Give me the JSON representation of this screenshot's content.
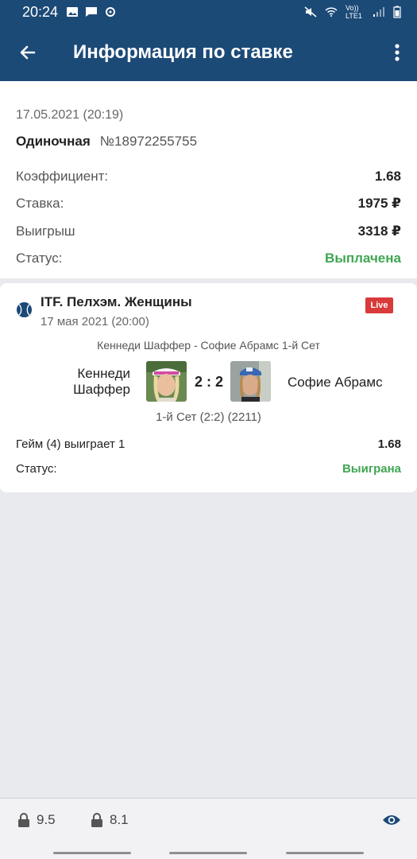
{
  "status_bar": {
    "time": "20:24",
    "network_label": "Vo)) LTE1"
  },
  "appbar": {
    "title": "Информация по ставке",
    "back_icon": "arrow-left-icon",
    "menu_icon": "more-vert-icon"
  },
  "bet": {
    "date": "17.05.2021 (20:19)",
    "type": "Одиночная",
    "number": "№18972255755",
    "rows": [
      {
        "label": "Коэффициент:",
        "value": "1.68"
      },
      {
        "label": "Ставка:",
        "value": "1975 ₽"
      },
      {
        "label": "Выигрыш",
        "value": "3318 ₽"
      },
      {
        "label": "Статус:",
        "value": "Выплачена"
      }
    ]
  },
  "event": {
    "tournament": "ITF. Пелхэм. Женщины",
    "date": "17 мая 2021 (20:00)",
    "live_badge": "Live",
    "match_name": "Кеннеди Шаффер - Софие Абрамс 1-й Сет",
    "player1_line1": "Кеннеди",
    "player1_line2": "Шаффер",
    "score": "2 : 2",
    "player2": "Софие Абрамс",
    "set_info": "1-й Сет (2:2) (2211)",
    "outcome": "Гейм (4) выиграет 1",
    "outcome_coef": "1.68",
    "status_label": "Статус:",
    "status_value": "Выиграна"
  },
  "bottom_bar": {
    "left_value": "9.5",
    "right_value": "8.1"
  },
  "colors": {
    "header": "#1c4a77",
    "green": "#3fa652",
    "live_red": "#d93a3a"
  }
}
